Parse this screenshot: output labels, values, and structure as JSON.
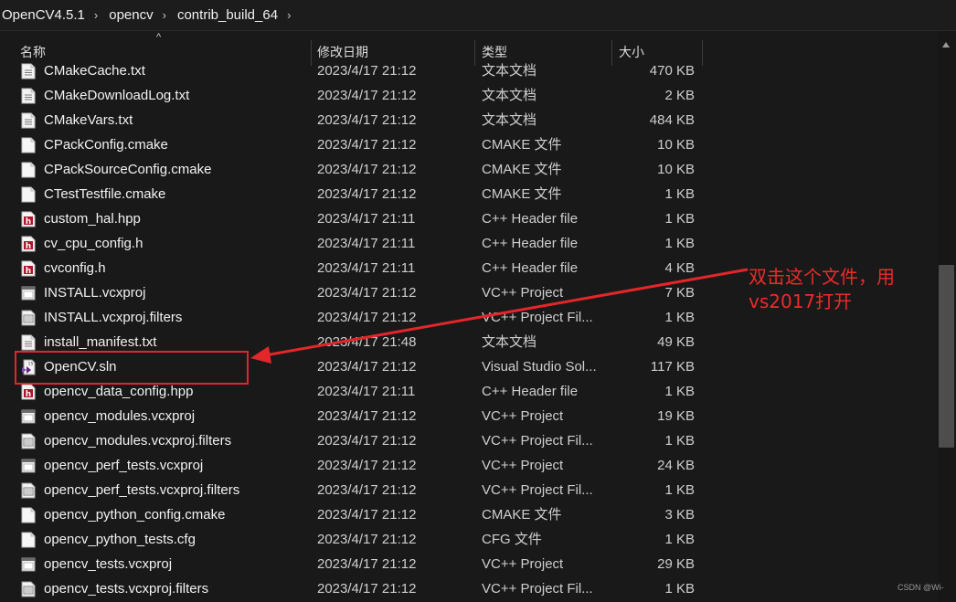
{
  "breadcrumb": {
    "items": [
      "OpenCV4.5.1",
      "opencv",
      "contrib_build_64"
    ],
    "separator": "›"
  },
  "columns": {
    "name": "名称",
    "date": "修改日期",
    "type": "类型",
    "size": "大小"
  },
  "files": [
    {
      "name": "CMakeCache.txt",
      "date": "2023/4/17 21:12",
      "type": "文本文档",
      "size": "470 KB",
      "icon": "text-file-icon"
    },
    {
      "name": "CMakeDownloadLog.txt",
      "date": "2023/4/17 21:12",
      "type": "文本文档",
      "size": "2 KB",
      "icon": "text-file-icon"
    },
    {
      "name": "CMakeVars.txt",
      "date": "2023/4/17 21:12",
      "type": "文本文档",
      "size": "484 KB",
      "icon": "text-file-icon"
    },
    {
      "name": "CPackConfig.cmake",
      "date": "2023/4/17 21:12",
      "type": "CMAKE 文件",
      "size": "10 KB",
      "icon": "blank-file-icon"
    },
    {
      "name": "CPackSourceConfig.cmake",
      "date": "2023/4/17 21:12",
      "type": "CMAKE 文件",
      "size": "10 KB",
      "icon": "blank-file-icon"
    },
    {
      "name": "CTestTestfile.cmake",
      "date": "2023/4/17 21:12",
      "type": "CMAKE 文件",
      "size": "1 KB",
      "icon": "blank-file-icon"
    },
    {
      "name": "custom_hal.hpp",
      "date": "2023/4/17 21:11",
      "type": "C++ Header file",
      "size": "1 KB",
      "icon": "header-file-icon"
    },
    {
      "name": "cv_cpu_config.h",
      "date": "2023/4/17 21:11",
      "type": "C++ Header file",
      "size": "1 KB",
      "icon": "header-file-icon"
    },
    {
      "name": "cvconfig.h",
      "date": "2023/4/17 21:11",
      "type": "C++ Header file",
      "size": "4 KB",
      "icon": "header-file-icon"
    },
    {
      "name": "INSTALL.vcxproj",
      "date": "2023/4/17 21:12",
      "type": "VC++ Project",
      "size": "7 KB",
      "icon": "vcxproj-file-icon"
    },
    {
      "name": "INSTALL.vcxproj.filters",
      "date": "2023/4/17 21:12",
      "type": "VC++ Project Fil...",
      "size": "1 KB",
      "icon": "filters-file-icon"
    },
    {
      "name": "install_manifest.txt",
      "date": "2023/4/17 21:48",
      "type": "文本文档",
      "size": "49 KB",
      "icon": "text-file-icon"
    },
    {
      "name": "OpenCV.sln",
      "date": "2023/4/17 21:12",
      "type": "Visual Studio Sol...",
      "size": "117 KB",
      "icon": "sln-file-icon"
    },
    {
      "name": "opencv_data_config.hpp",
      "date": "2023/4/17 21:11",
      "type": "C++ Header file",
      "size": "1 KB",
      "icon": "header-file-icon"
    },
    {
      "name": "opencv_modules.vcxproj",
      "date": "2023/4/17 21:12",
      "type": "VC++ Project",
      "size": "19 KB",
      "icon": "vcxproj-file-icon"
    },
    {
      "name": "opencv_modules.vcxproj.filters",
      "date": "2023/4/17 21:12",
      "type": "VC++ Project Fil...",
      "size": "1 KB",
      "icon": "filters-file-icon"
    },
    {
      "name": "opencv_perf_tests.vcxproj",
      "date": "2023/4/17 21:12",
      "type": "VC++ Project",
      "size": "24 KB",
      "icon": "vcxproj-file-icon"
    },
    {
      "name": "opencv_perf_tests.vcxproj.filters",
      "date": "2023/4/17 21:12",
      "type": "VC++ Project Fil...",
      "size": "1 KB",
      "icon": "filters-file-icon"
    },
    {
      "name": "opencv_python_config.cmake",
      "date": "2023/4/17 21:12",
      "type": "CMAKE 文件",
      "size": "3 KB",
      "icon": "blank-file-icon"
    },
    {
      "name": "opencv_python_tests.cfg",
      "date": "2023/4/17 21:12",
      "type": "CFG 文件",
      "size": "1 KB",
      "icon": "blank-file-icon"
    },
    {
      "name": "opencv_tests.vcxproj",
      "date": "2023/4/17 21:12",
      "type": "VC++ Project",
      "size": "29 KB",
      "icon": "vcxproj-file-icon"
    },
    {
      "name": "opencv_tests.vcxproj.filters",
      "date": "2023/4/17 21:12",
      "type": "VC++ Project Fil...",
      "size": "1 KB",
      "icon": "filters-file-icon"
    }
  ],
  "annotation": {
    "line1": "双击这个文件，用",
    "line2": "vs2017打开",
    "color": "#ee2a2a"
  },
  "watermark": "CSDN @Wi-",
  "colors": {
    "background": "#191919",
    "text": "#e6e6e6",
    "highlight": "#e3262a"
  }
}
